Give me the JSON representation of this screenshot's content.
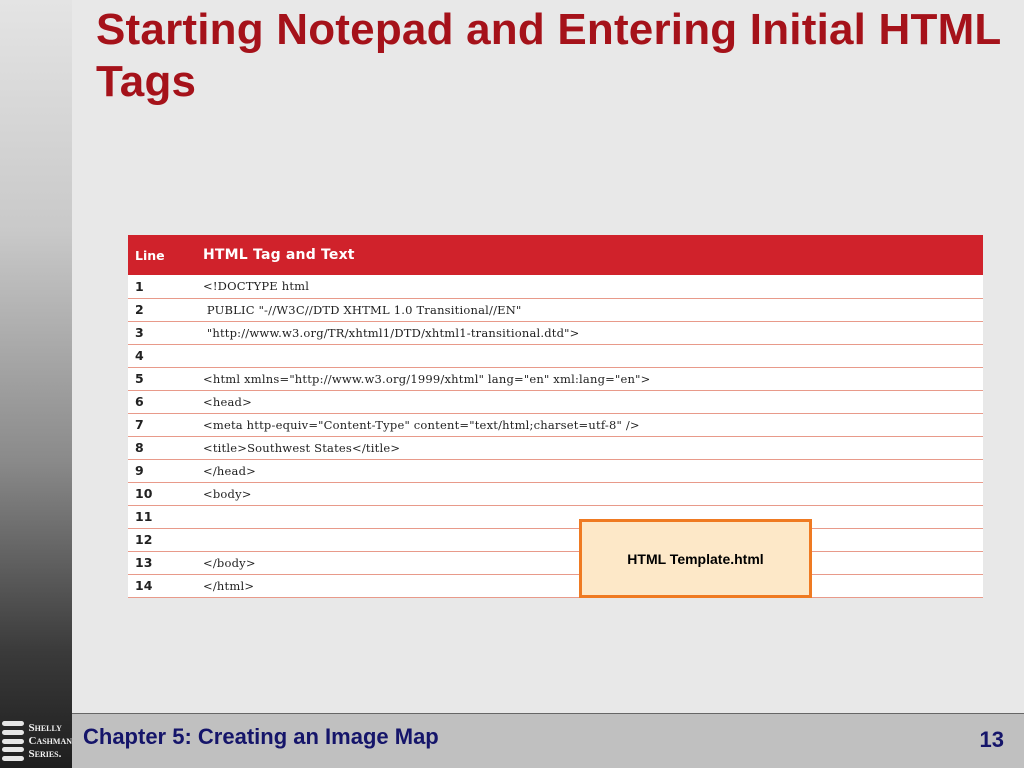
{
  "slide": {
    "title": "Starting Notepad and Entering Initial HTML Tags",
    "callout": "HTML Template.html"
  },
  "table": {
    "headers": [
      "Line",
      "HTML Tag and Text"
    ],
    "rows": [
      {
        "line": "1",
        "code": "<!DOCTYPE html"
      },
      {
        "line": "2",
        "code": " PUBLIC \"-//W3C//DTD XHTML 1.0 Transitional//EN\""
      },
      {
        "line": "3",
        "code": " \"http://www.w3.org/TR/xhtml1/DTD/xhtml1-transitional.dtd\">"
      },
      {
        "line": "4",
        "code": ""
      },
      {
        "line": "5",
        "code": "<html xmlns=\"http://www.w3.org/1999/xhtml\" lang=\"en\" xml:lang=\"en\">"
      },
      {
        "line": "6",
        "code": "<head>"
      },
      {
        "line": "7",
        "code": "<meta http-equiv=\"Content-Type\" content=\"text/html;charset=utf-8\" />"
      },
      {
        "line": "8",
        "code": "<title>Southwest States</title>"
      },
      {
        "line": "9",
        "code": "</head>"
      },
      {
        "line": "10",
        "code": "<body>"
      },
      {
        "line": "11",
        "code": ""
      },
      {
        "line": "12",
        "code": ""
      },
      {
        "line": "13",
        "code": "</body>"
      },
      {
        "line": "14",
        "code": "</html>"
      }
    ]
  },
  "footer": {
    "chapter": "Chapter 5: Creating an Image Map",
    "page": "13"
  },
  "logo": {
    "lines": [
      "Shelly",
      "Cashman",
      "Series."
    ]
  }
}
